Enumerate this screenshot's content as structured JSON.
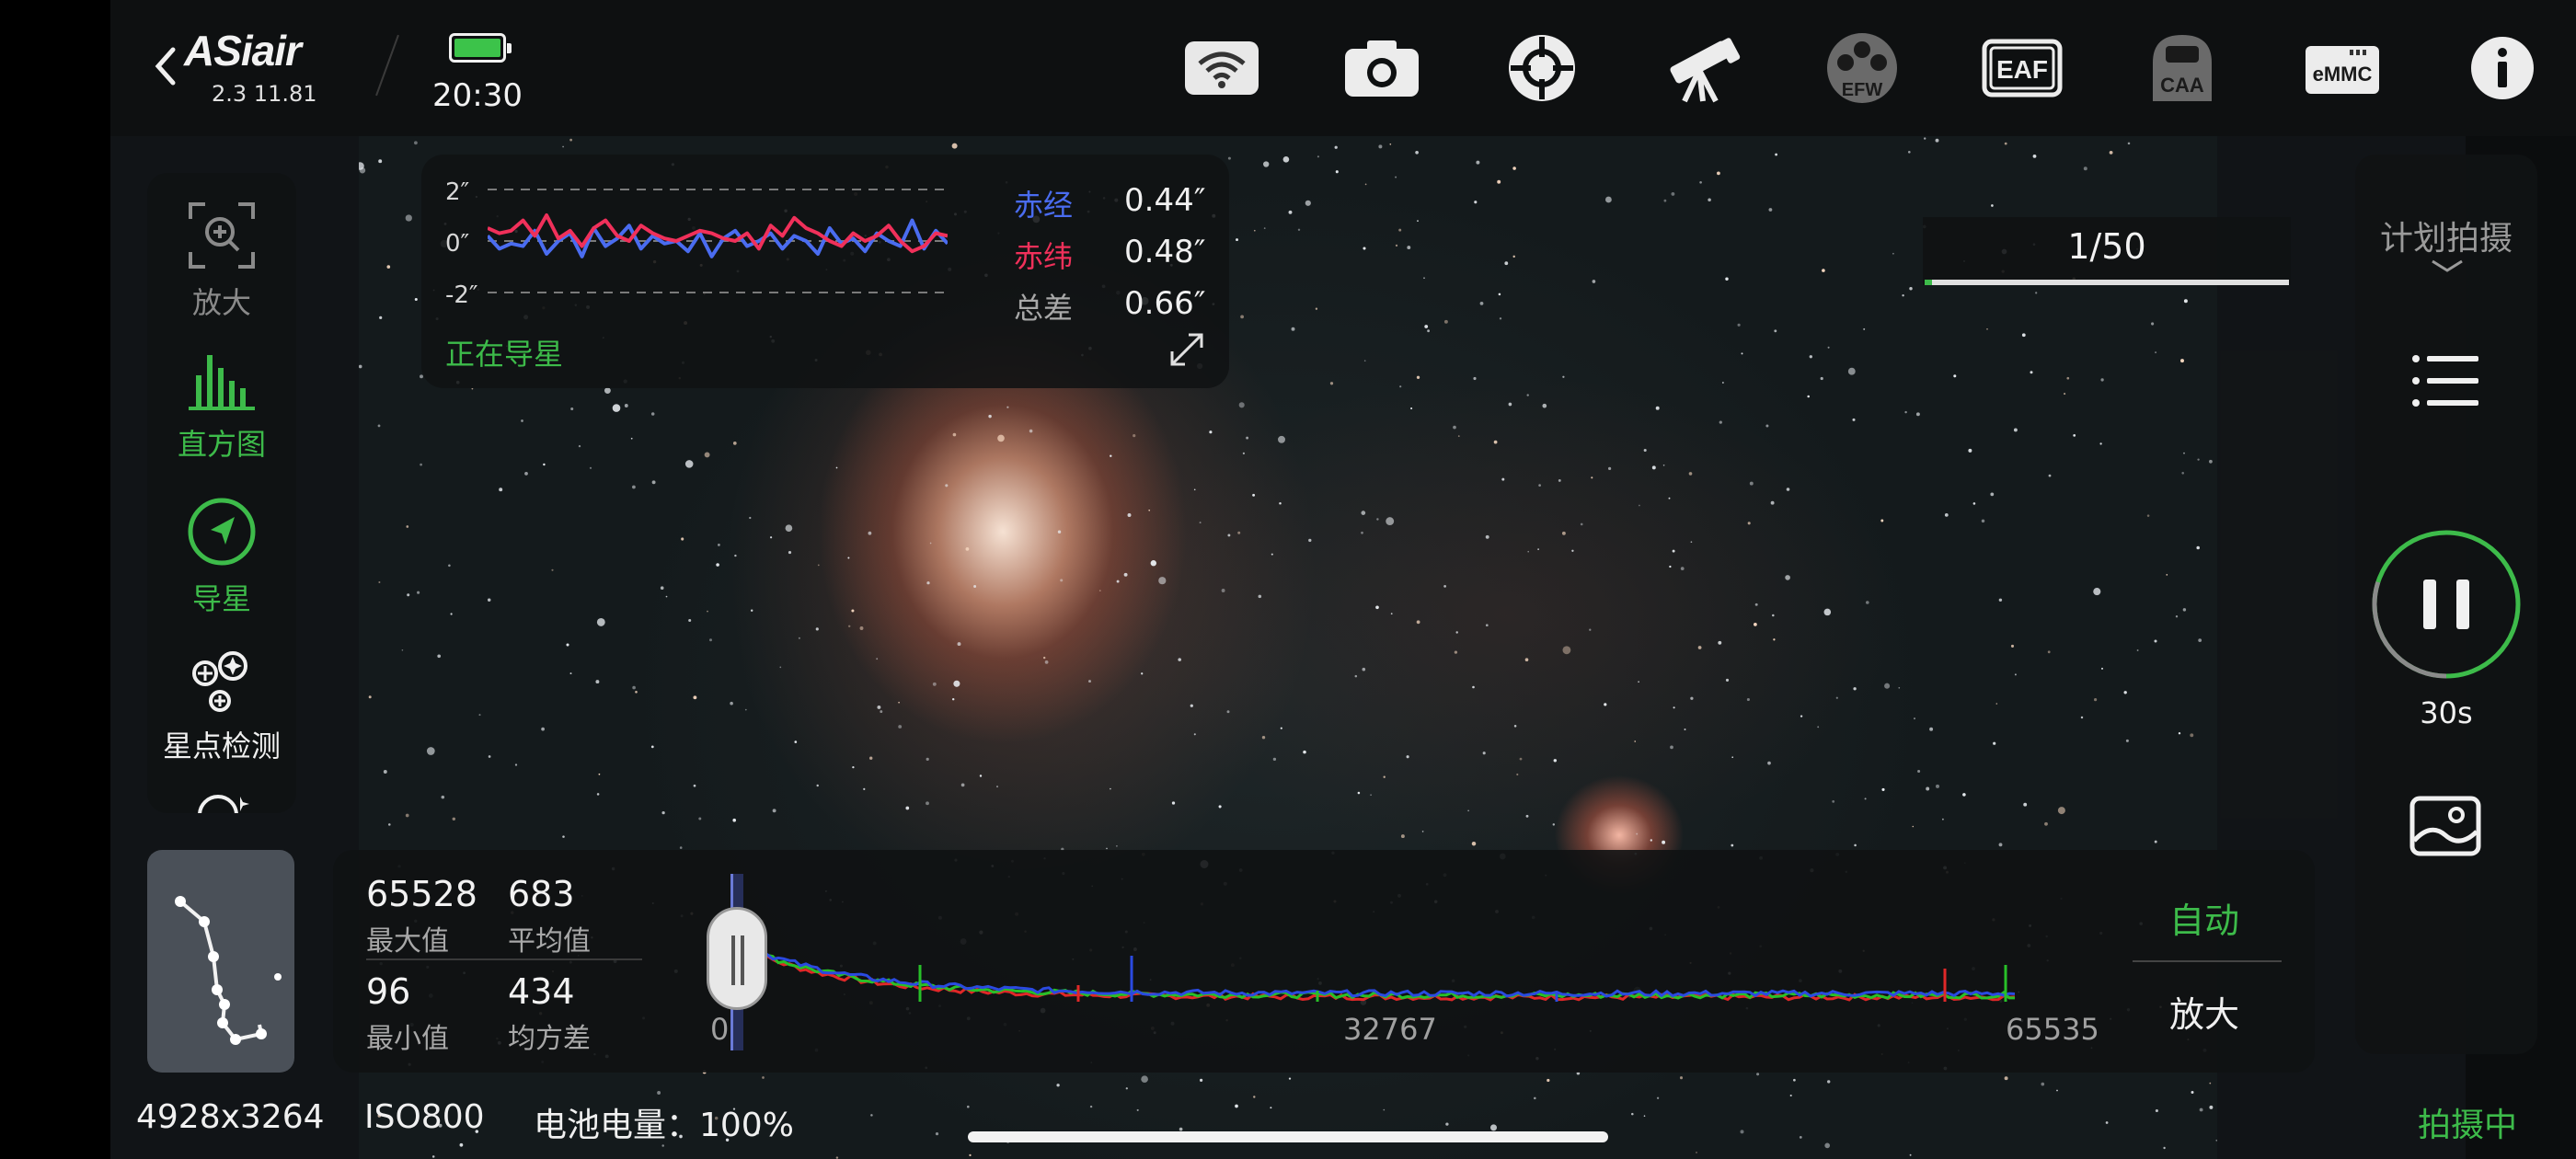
{
  "header": {
    "brand": "ASiair",
    "version": "2.3 11.81",
    "time": "20:30",
    "icons": [
      "wifi-icon",
      "camera-icon",
      "mount-icon",
      "telescope-icon",
      "efw-icon",
      "eaf-icon",
      "caa-icon",
      "emmc-icon",
      "info-icon"
    ],
    "efw_label": "EFW",
    "eaf_label": "EAF",
    "caa_label": "CAA",
    "emmc_label": "eMMC"
  },
  "guide": {
    "y_labels": [
      "2″",
      "0″",
      "-2″"
    ],
    "ra_label": "赤经",
    "ra_value": "0.44″",
    "dec_label": "赤纬",
    "dec_value": "0.48″",
    "total_label": "总差",
    "total_value": "0.66″",
    "status": "正在导星",
    "colors": {
      "ra": "#4a6cf0",
      "dec": "#f0305a",
      "status": "#3dbb4a"
    },
    "ra_series": [
      0.2,
      -0.3,
      -0.1,
      -0.2,
      0.4,
      -0.5,
      0.0,
      0.3,
      -0.6,
      0.5,
      -0.2,
      0.1,
      0.6,
      -0.3,
      0.2,
      -0.1,
      0.0,
      -0.4,
      0.3,
      -0.6,
      0.1,
      0.4,
      -0.2,
      0.0,
      0.3,
      -0.3,
      0.2,
      0.0,
      -0.5,
      0.5,
      -0.1,
      0.1,
      -0.4,
      0.3,
      0.0,
      -0.2,
      0.8,
      -0.3,
      0.4,
      -0.1
    ],
    "dec_series": [
      0.5,
      0.3,
      0.4,
      0.8,
      0.2,
      1.0,
      0.1,
      0.4,
      -0.2,
      0.5,
      0.8,
      0.2,
      0.0,
      0.6,
      0.3,
      0.1,
      0.0,
      0.2,
      0.4,
      0.3,
      0.1,
      0.0,
      0.3,
      -0.3,
      0.6,
      0.2,
      0.9,
      0.5,
      0.3,
      0.0,
      -0.2,
      0.3,
      0.0,
      0.2,
      0.6,
      0.0,
      -0.4,
      -0.2,
      0.3,
      0.2
    ]
  },
  "left_tools": {
    "zoom": "放大",
    "histogram": "直方图",
    "guide": "导星",
    "star_detect": "星点检测"
  },
  "histogram": {
    "max_value": "65528",
    "max_label": "最大值",
    "mean_value": "683",
    "mean_label": "平均值",
    "min_value": "96",
    "min_label": "最小值",
    "std_value": "434",
    "std_label": "均方差",
    "ticks": [
      "0",
      "32767",
      "65535"
    ],
    "auto_label": "自动",
    "zoom_label": "放大"
  },
  "plan": {
    "title": "计划拍摄",
    "timer": "30s",
    "timer_progress": 0.3
  },
  "progress": {
    "text": "1/50",
    "fraction": 0.02
  },
  "footer": {
    "resolution": "4928x3264",
    "iso": "ISO800",
    "battery": "电池电量：100%",
    "status": "拍摄中"
  }
}
